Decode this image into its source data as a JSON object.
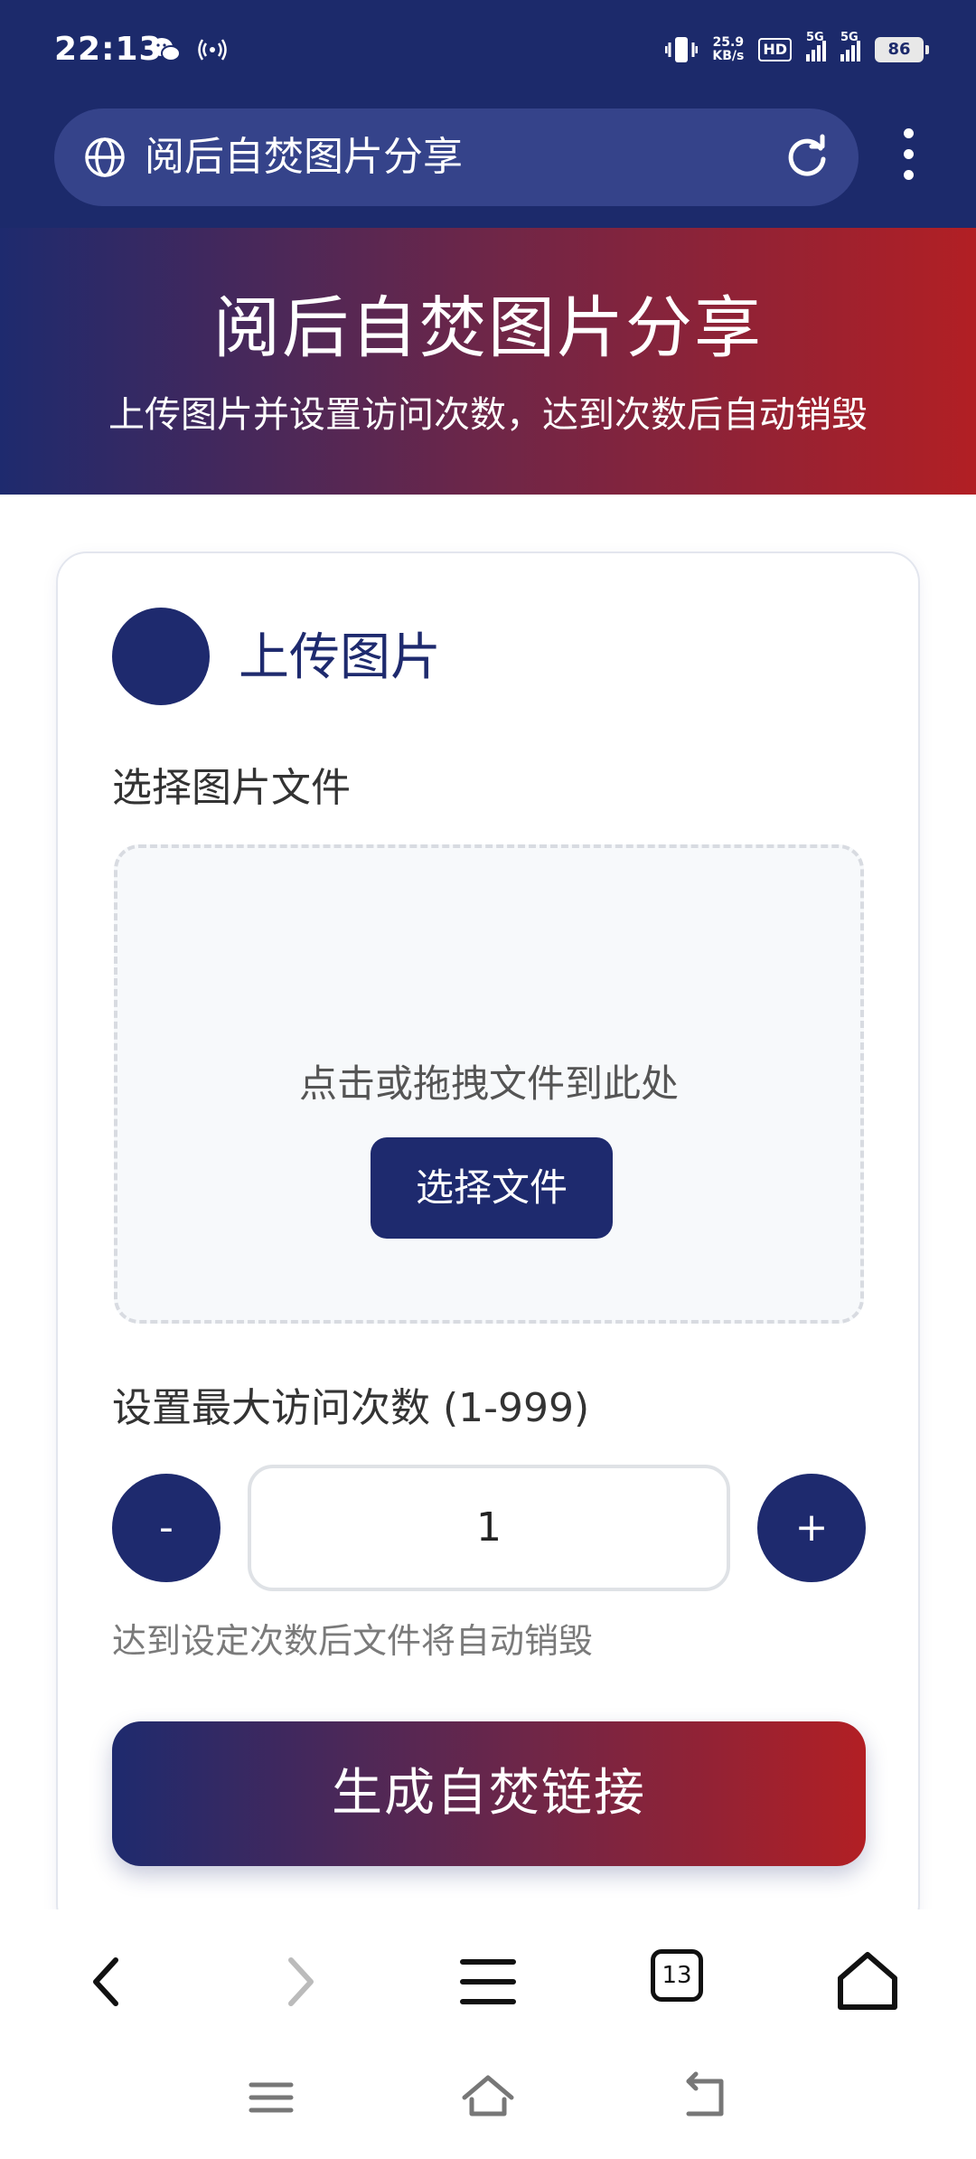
{
  "status_bar": {
    "time": "22:13",
    "net_speed_value": "25.9",
    "net_speed_unit": "KB/s",
    "hd_label": "HD",
    "sim1_label": "5G",
    "sim2_label": "5G",
    "battery": "86"
  },
  "browser": {
    "address_text": "阅后自焚图片分享",
    "tab_count": "13"
  },
  "hero": {
    "title": "阅后自焚图片分享",
    "subtitle": "上传图片并设置访问次数，达到次数后自动销毁"
  },
  "upload_card": {
    "title": "上传图片",
    "file_label": "选择图片文件",
    "drop_hint": "点击或拖拽文件到此处",
    "choose_button": "选择文件",
    "max_visits_label": "设置最大访问次数 (1-999)",
    "decrement_label": "-",
    "increment_label": "+",
    "visit_count": "1",
    "hint": "达到设定次数后文件将自动销毁",
    "generate_button": "生成自焚链接"
  },
  "colors": {
    "primary": "#1e2a6e",
    "accent": "#b21f24",
    "chrome": "#1c2a6b"
  }
}
